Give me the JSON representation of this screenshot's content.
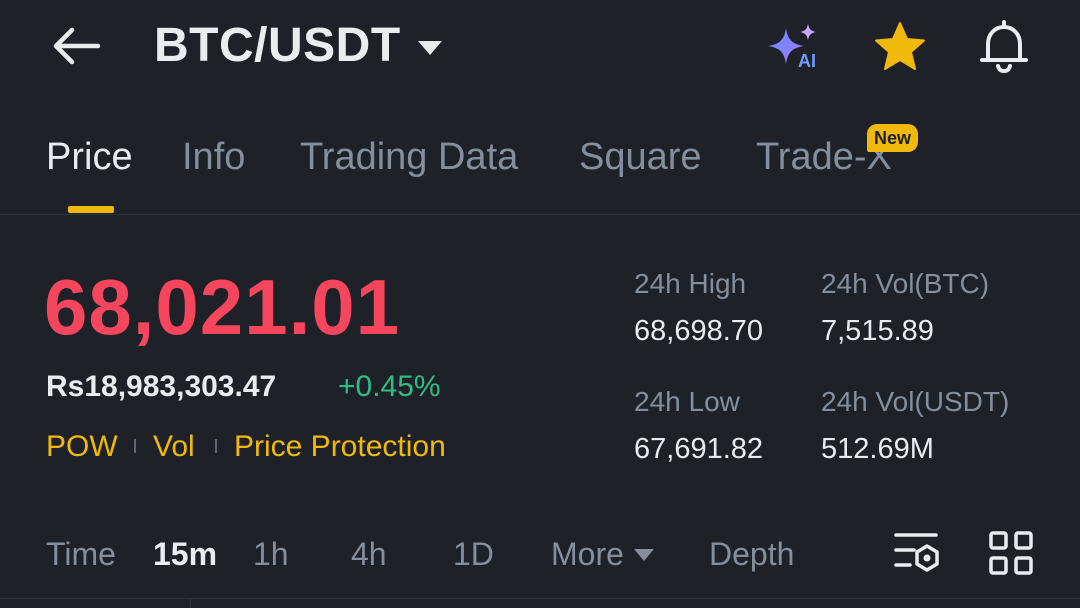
{
  "header": {
    "pair": "BTC/USDT",
    "icons": [
      "back-arrow-icon",
      "pair-dropdown-icon",
      "ai-sparkle-icon",
      "favorite-star-icon",
      "bell-icon"
    ],
    "ai_label": "AI"
  },
  "tabs": {
    "items": [
      "Price",
      "Info",
      "Trading Data",
      "Square",
      "Trade-X"
    ],
    "active": "Price",
    "new_badge": "New"
  },
  "ticker": {
    "last_price": "68,021.01",
    "fiat_price": "Rs18,983,303.47",
    "change_pct": "+0.45%",
    "tags": [
      "POW",
      "Vol",
      "Price Protection"
    ],
    "high_label": "24h High",
    "high_value": "68,698.70",
    "low_label": "24h Low",
    "low_value": "67,691.82",
    "vol_btc_label": "24h Vol(BTC)",
    "vol_btc_value": "7,515.89",
    "vol_usdt_label": "24h Vol(USDT)",
    "vol_usdt_value": "512.69M"
  },
  "timeframes": {
    "label": "Time",
    "items": [
      "15m",
      "1h",
      "4h",
      "1D"
    ],
    "active": "15m",
    "more": "More",
    "depth": "Depth"
  },
  "colors": {
    "background": "#1e2128",
    "accent": "#f0b90b",
    "down": "#f6465d",
    "up": "#2ebd85",
    "muted": "#848e9c"
  }
}
